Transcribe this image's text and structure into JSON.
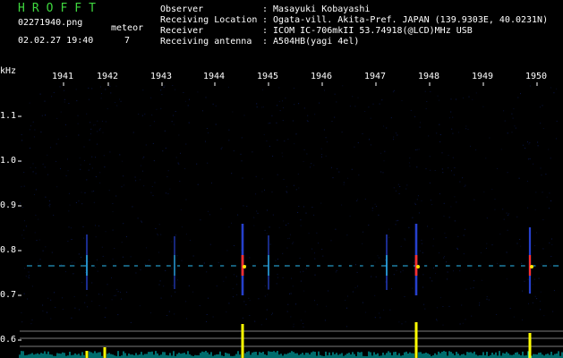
{
  "header": {
    "title": "HROFFT",
    "filename": "02271940.png",
    "datetime": "02.02.27 19:40",
    "meteor_label": "meteor",
    "meteor_count": "7"
  },
  "station": {
    "observer_label": "Observer",
    "observer_value": ": Masayuki Kobayashi",
    "location_label": "Receiving Location",
    "location_value": ": Ogata-vill. Akita-Pref. JAPAN (139.9303E, 40.0231N)",
    "receiver_label": "Receiver",
    "receiver_value": ": ICOM IC-706mkII 53.74918(@LCD)MHz USB",
    "antenna_label": "Receiving antenna",
    "antenna_value": ": A504HB(yagi 4el)"
  },
  "axis": {
    "y_unit": "kHz",
    "y_ticks": [
      "1.1",
      "1.0",
      "0.9",
      "0.8",
      "0.7",
      "0.6"
    ],
    "x_ticks": [
      "1941",
      "1942",
      "1943",
      "1944",
      "1945",
      "1946",
      "1947",
      "1948",
      "1949",
      "1950"
    ]
  },
  "colors": {
    "background": "#000000",
    "title": "#3fd83f",
    "signal_line": "#2ec4ff",
    "meteor_hot": "#ff3030",
    "meteor_warm": "#ffe400",
    "amplitude_peak": "#ffff00",
    "amplitude_base": "#00d8d8",
    "grid_line": "#cfcfcf"
  }
}
